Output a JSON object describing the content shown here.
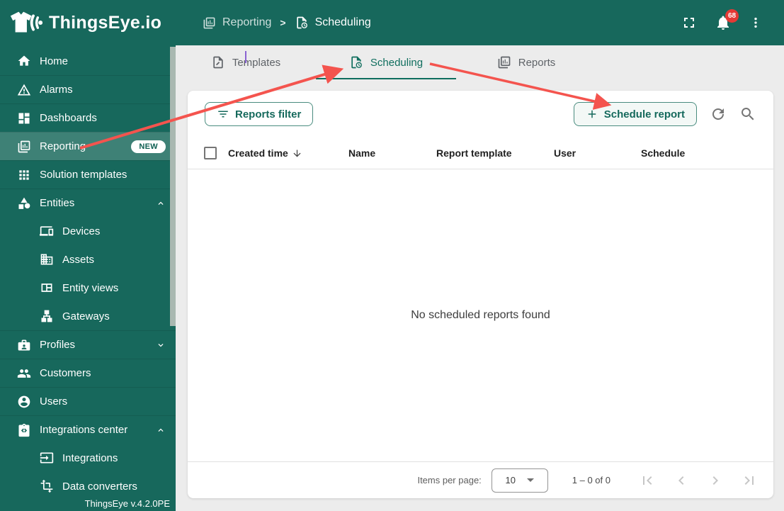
{
  "colors": {
    "primary_teal": "#17685c",
    "selected_item_teal": "#3e8176",
    "accent_teal": "#0f6e5e",
    "notification_red": "#e53935",
    "annotation_arrow_red": "#f4544e",
    "page_background": "#ececec",
    "card_background": "#ffffff"
  },
  "header": {
    "brand": "ThingsEye.io",
    "breadcrumb": {
      "parent": "Reporting",
      "separator": ">",
      "current": "Scheduling"
    },
    "notification_badge": "68"
  },
  "sidebar": {
    "version": "ThingsEye v.4.2.0PE",
    "items": [
      {
        "label": "Home",
        "icon": "home-icon"
      },
      {
        "label": "Alarms",
        "icon": "warning-icon"
      },
      {
        "label": "Dashboards",
        "icon": "dashboard-icon"
      },
      {
        "label": "Reporting",
        "icon": "report-chart-icon",
        "badge": "NEW",
        "selected": true
      },
      {
        "label": "Solution templates",
        "icon": "grid-icon"
      },
      {
        "label": "Entities",
        "icon": "category-icon",
        "expanded": true
      },
      {
        "label": "Devices",
        "icon": "devices-icon",
        "child": true
      },
      {
        "label": "Assets",
        "icon": "building-icon",
        "child": true
      },
      {
        "label": "Entity views",
        "icon": "view-quilt-icon",
        "child": true
      },
      {
        "label": "Gateways",
        "icon": "lan-icon",
        "child": true
      },
      {
        "label": "Profiles",
        "icon": "badge-icon",
        "collapsed": true
      },
      {
        "label": "Customers",
        "icon": "people-icon"
      },
      {
        "label": "Users",
        "icon": "account-circle-icon"
      },
      {
        "label": "Integrations center",
        "icon": "clipboard-code-icon",
        "expanded": true
      },
      {
        "label": "Integrations",
        "icon": "input-icon",
        "child": true
      },
      {
        "label": "Data converters",
        "icon": "transform-icon",
        "child": true
      }
    ]
  },
  "tabs": [
    {
      "label": "Templates",
      "icon": "document-edit-icon"
    },
    {
      "label": "Scheduling",
      "icon": "document-clock-icon",
      "active": true
    },
    {
      "label": "Reports",
      "icon": "report-chart-icon"
    }
  ],
  "toolbar": {
    "reports_filter": "Reports filter",
    "schedule_report": "Schedule report"
  },
  "table": {
    "columns": [
      "Created time",
      "Name",
      "Report template",
      "User",
      "Schedule"
    ],
    "sorted_by": "Created time",
    "sort_direction": "desc",
    "empty_text": "No scheduled reports found"
  },
  "pagination": {
    "items_per_page_label": "Items per page:",
    "page_size": "10",
    "range": "1 – 0 of 0"
  }
}
